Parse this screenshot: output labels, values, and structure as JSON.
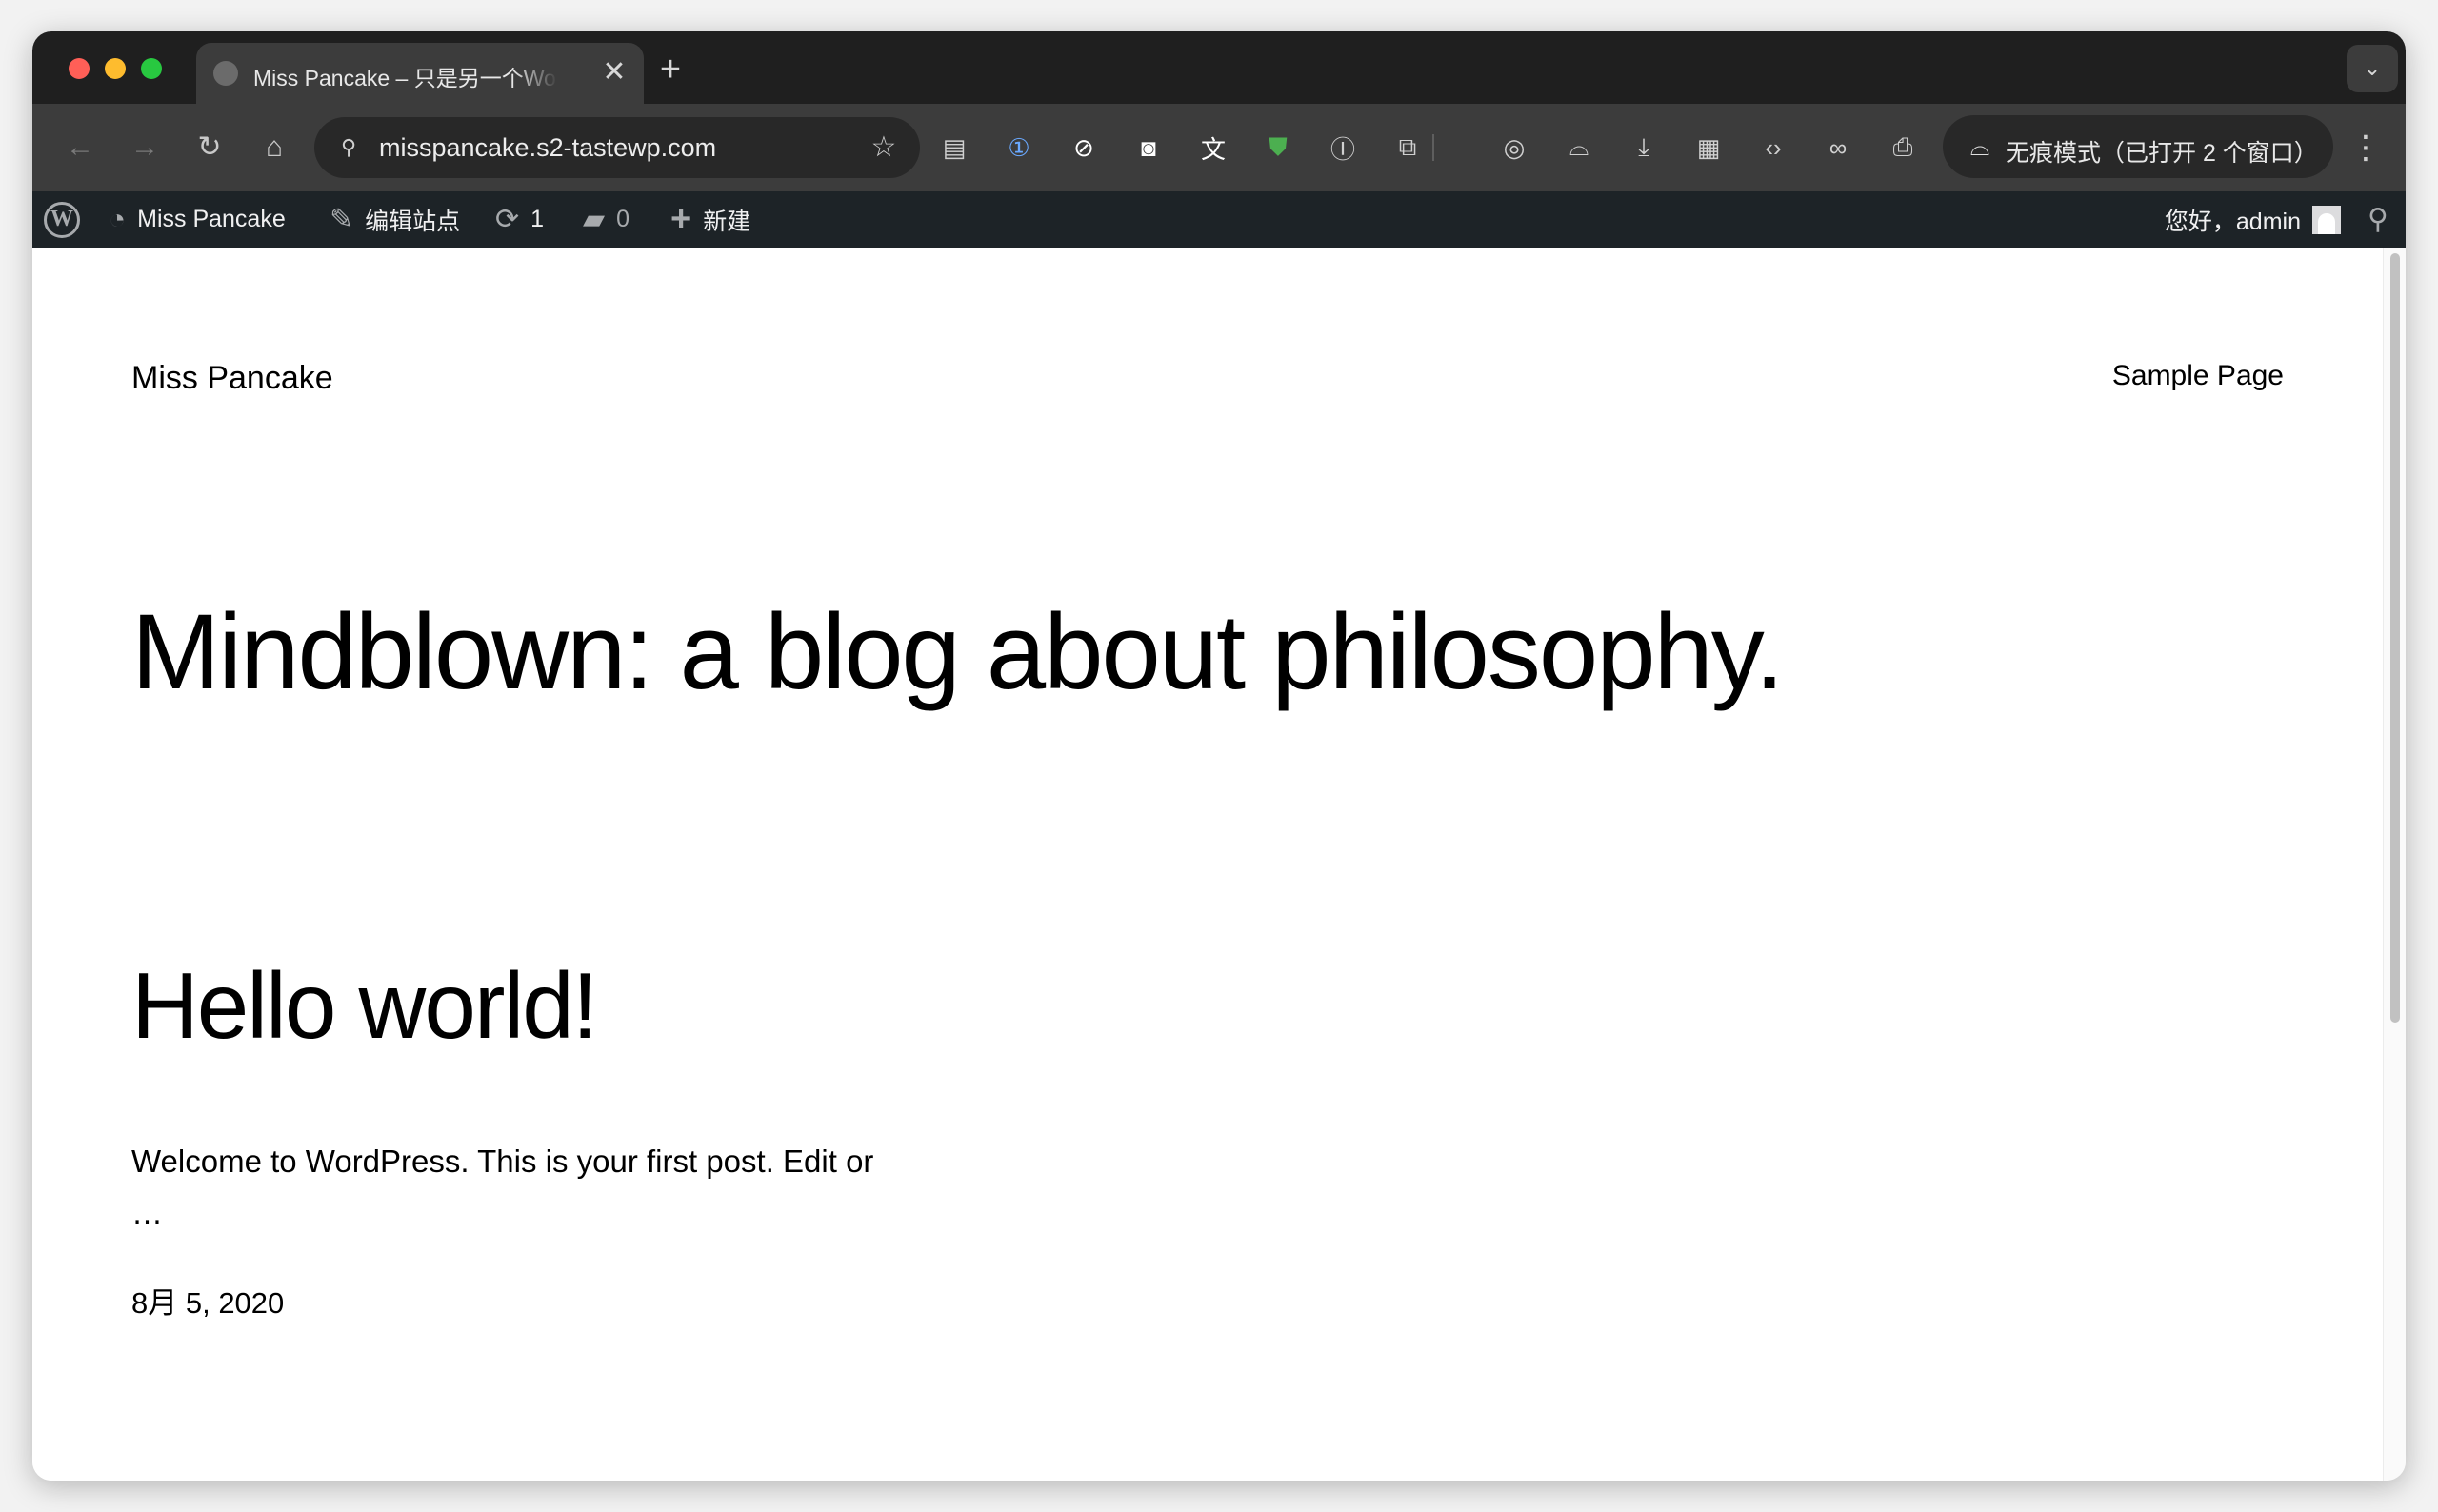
{
  "browser": {
    "tab": {
      "title": "Miss Pancake – 只是另一个WordPress站点",
      "close_glyph": "✕"
    },
    "new_tab_glyph": "+",
    "tab_search_glyph": "⌄",
    "nav": {
      "back_glyph": "←",
      "forward_glyph": "→",
      "reload_glyph": "↻",
      "home_glyph": "⌂"
    },
    "omnibox": {
      "url": "misspancake.s2-tastewp.com",
      "site_info_glyph": "⚲",
      "star_glyph": "☆"
    },
    "extensions": [
      {
        "name": "reader-mode-icon",
        "glyph": "▤",
        "color": "#d0d0d0"
      },
      {
        "name": "onepassword-icon",
        "glyph": "①",
        "color": "#6aa9ff"
      },
      {
        "name": "ublock-icon",
        "glyph": "⊘",
        "color": "#ffffff"
      },
      {
        "name": "ghostery-icon",
        "glyph": "◙",
        "color": "#ffffff"
      },
      {
        "name": "translate-icon",
        "glyph": "文",
        "color": "#ffffff"
      },
      {
        "name": "shield-icon",
        "glyph": "⛊",
        "color": "#4caf50"
      },
      {
        "name": "ip-icon",
        "glyph": "Ⓘ",
        "color": "#d0d0d0"
      },
      {
        "name": "extensions-puzzle-icon",
        "glyph": "⧉",
        "color": "#d0d0d0"
      },
      {
        "name": "screenshot-icon",
        "glyph": "◎",
        "color": "#d0d0d0"
      },
      {
        "name": "incognito-ext-icon",
        "glyph": "⌓",
        "color": "#d0d0d0"
      },
      {
        "name": "download-icon",
        "glyph": "⤓",
        "color": "#d0d0d0"
      },
      {
        "name": "qr-code-icon",
        "glyph": "▦",
        "color": "#d0d0d0"
      },
      {
        "name": "code-icon",
        "glyph": "‹›",
        "color": "#d0d0d0"
      },
      {
        "name": "link-icon",
        "glyph": "∞",
        "color": "#d0d0d0"
      },
      {
        "name": "print-icon",
        "glyph": "⎙",
        "color": "#d0d0d0"
      }
    ],
    "incognito": {
      "glyph": "⌓",
      "label": "无痕模式（已打开 2 个窗口）"
    },
    "menu_glyph": "⋮"
  },
  "adminbar": {
    "wp_logo_glyph": "W",
    "site_name": "Miss Pancake",
    "site_icon_glyph": "◔",
    "edit_site_label": "编辑站点",
    "edit_icon_glyph": "✎",
    "updates_glyph": "⟳",
    "updates_count": "1",
    "comments_glyph": "▰",
    "comments_count": "0",
    "new_glyph": "+",
    "new_label": "新建",
    "greeting": "您好，admin",
    "search_glyph": "⚲"
  },
  "page": {
    "site_title": "Miss Pancake",
    "nav_link": "Sample Page",
    "headline": "Mindblown: a blog about philosophy.",
    "post": {
      "title": "Hello world!",
      "excerpt": "Welcome to WordPress. This is your first post. Edit or …",
      "date": "8月 5, 2020"
    }
  }
}
